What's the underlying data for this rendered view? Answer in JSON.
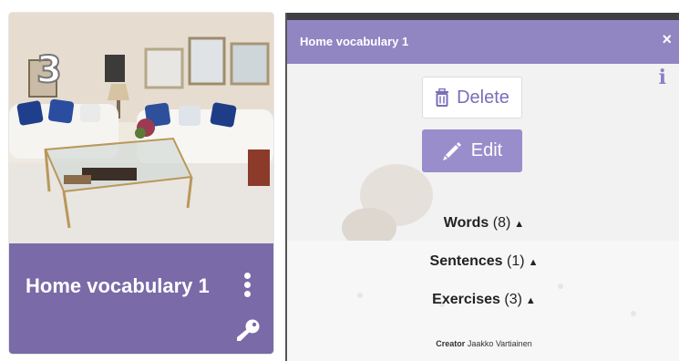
{
  "card": {
    "number": "3",
    "title": "Home vocabulary 1",
    "icons": {
      "menu": "kebab-menu-icon",
      "key": "key-icon"
    }
  },
  "panel": {
    "title": "Home vocabulary 1",
    "close_label": "×",
    "info_label": "i",
    "delete_label": "Delete",
    "edit_label": "Edit",
    "sections": [
      {
        "name": "Words",
        "count": "(8)"
      },
      {
        "name": "Sentences",
        "count": "(1)"
      },
      {
        "name": "Exercises",
        "count": "(3)"
      }
    ],
    "creator_label": "Creator",
    "creator_name": "Jaakko Vartiainen"
  },
  "colors": {
    "accent": "#7a6aa8",
    "header": "#9186c2",
    "edit_button": "#9a8dcb"
  }
}
